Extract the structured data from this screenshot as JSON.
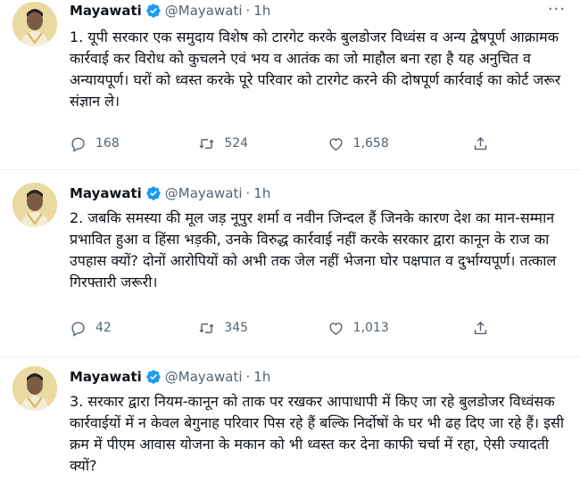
{
  "tweets": [
    {
      "author": "Mayawati",
      "handle": "@Mayawati",
      "separator": "·",
      "time": "1h",
      "text": "1. यूपी सरकार एक समुदाय विशेष को टारगेट करके बुलडोजर विध्वंस व अन्य द्वेषपूर्ण आक्रामक कार्रवाई कर विरोध को कुचलने एवं भय व आतंक का जो माहौल बना रहा है यह अनुचित व अन्यायपूर्ण। घरों को ध्वस्त करके पूरे परिवार को टारगेट करने की दोषपूर्ण कार्रवाई का कोर्ट जरूर संज्ञान ले।",
      "replies": "168",
      "retweets": "524",
      "likes": "1,658"
    },
    {
      "author": "Mayawati",
      "handle": "@Mayawati",
      "separator": "·",
      "time": "1h",
      "text": "2. जबकि समस्या की मूल जड़ नूपुर शर्मा व नवीन जिन्दल हैं जिनके कारण देश का मान-सम्मान प्रभावित हुआ व हिंसा भड़की, उनके विरुद्ध कार्रवाई नहीं करके सरकार द्वारा कानून के राज का उपहास क्यों? दोनों आरोपियों को अभी तक जेल नहीं भेजना घोर पक्षपात व दुर्भाग्यपूर्ण। तत्काल गिरफ्तारी जरूरी।",
      "replies": "42",
      "retweets": "345",
      "likes": "1,013"
    },
    {
      "author": "Mayawati",
      "handle": "@Mayawati",
      "separator": "·",
      "time": "1h",
      "text": "3. सरकार द्वारा नियम-कानून को ताक पर रखकर आपाधापी में किए जा रहे बुलडोजर विध्वंसक कार्रवाईयों में न केवल बेगुनाह परिवार पिस रहे हैं बल्कि निर्दोषों के घर भी ढह दिए जा रहे हैं। इसी क्रम में पीएम आवास योजना के मकान को भी ध्वस्त कर देना काफी चर्चा में रहा, ऐसी ज्यादती क्यों?"
    }
  ],
  "icons": {
    "verified": "verified-badge-icon",
    "more": "more-options-icon",
    "reply": "reply-icon",
    "retweet": "retweet-icon",
    "like": "like-icon",
    "share": "share-icon"
  },
  "colors": {
    "verified": "#1d9bf0",
    "muted": "#536471",
    "text": "#0f1419"
  }
}
